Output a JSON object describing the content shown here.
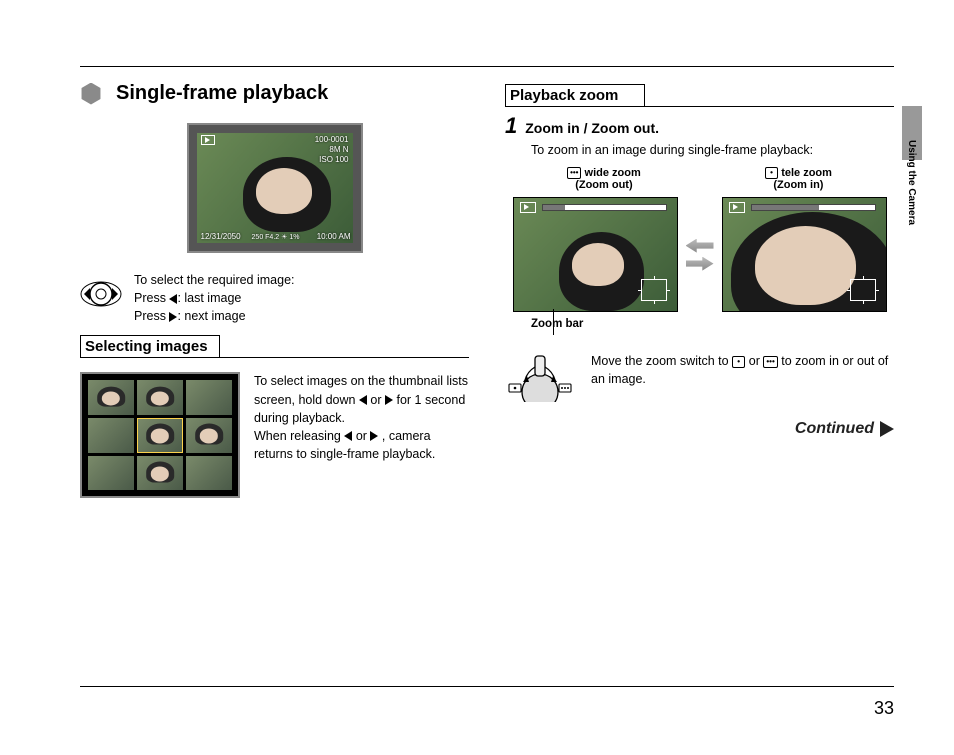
{
  "page_number": "33",
  "side_tab_text": "Using the Camera",
  "left": {
    "heading": "Single-frame playback",
    "display": {
      "top_right_1": "100-0001",
      "top_right_2": "8M N",
      "top_right_3": "ISO 100",
      "bottom_left": "12/31/2050",
      "bottom_mid": "10:00 AM",
      "bottom_vals": "250   F4.2   ☀ 1%"
    },
    "select_intro": "To select the required image:",
    "select_last": "Press ◀: last image",
    "select_next": "Press ▶: next image",
    "section_title": "Selecting images",
    "thumb_text_1": "To select images on the thumbnail lists screen, hold down ◀ or ▶ for 1 second during playback.",
    "thumb_text_2": "When releasing ◀ or ▶, camera returns to single-frame playback."
  },
  "right": {
    "section_title": "Playback zoom",
    "step_num": "1",
    "step_title": "Zoom in / Zoom out.",
    "step_desc": "To zoom in an image during single-frame playback:",
    "wide_label_1": "wide zoom",
    "wide_label_2": "(Zoom out)",
    "tele_label_1": "tele zoom",
    "tele_label_2": "(Zoom in)",
    "wide_icon": "[•••]",
    "tele_icon": "[•]",
    "zoom_bar_label": "Zoom bar",
    "lever_text": "Move the zoom switch to [•] or [•••] to zoom in or out of an image.",
    "continued": "Continued"
  }
}
